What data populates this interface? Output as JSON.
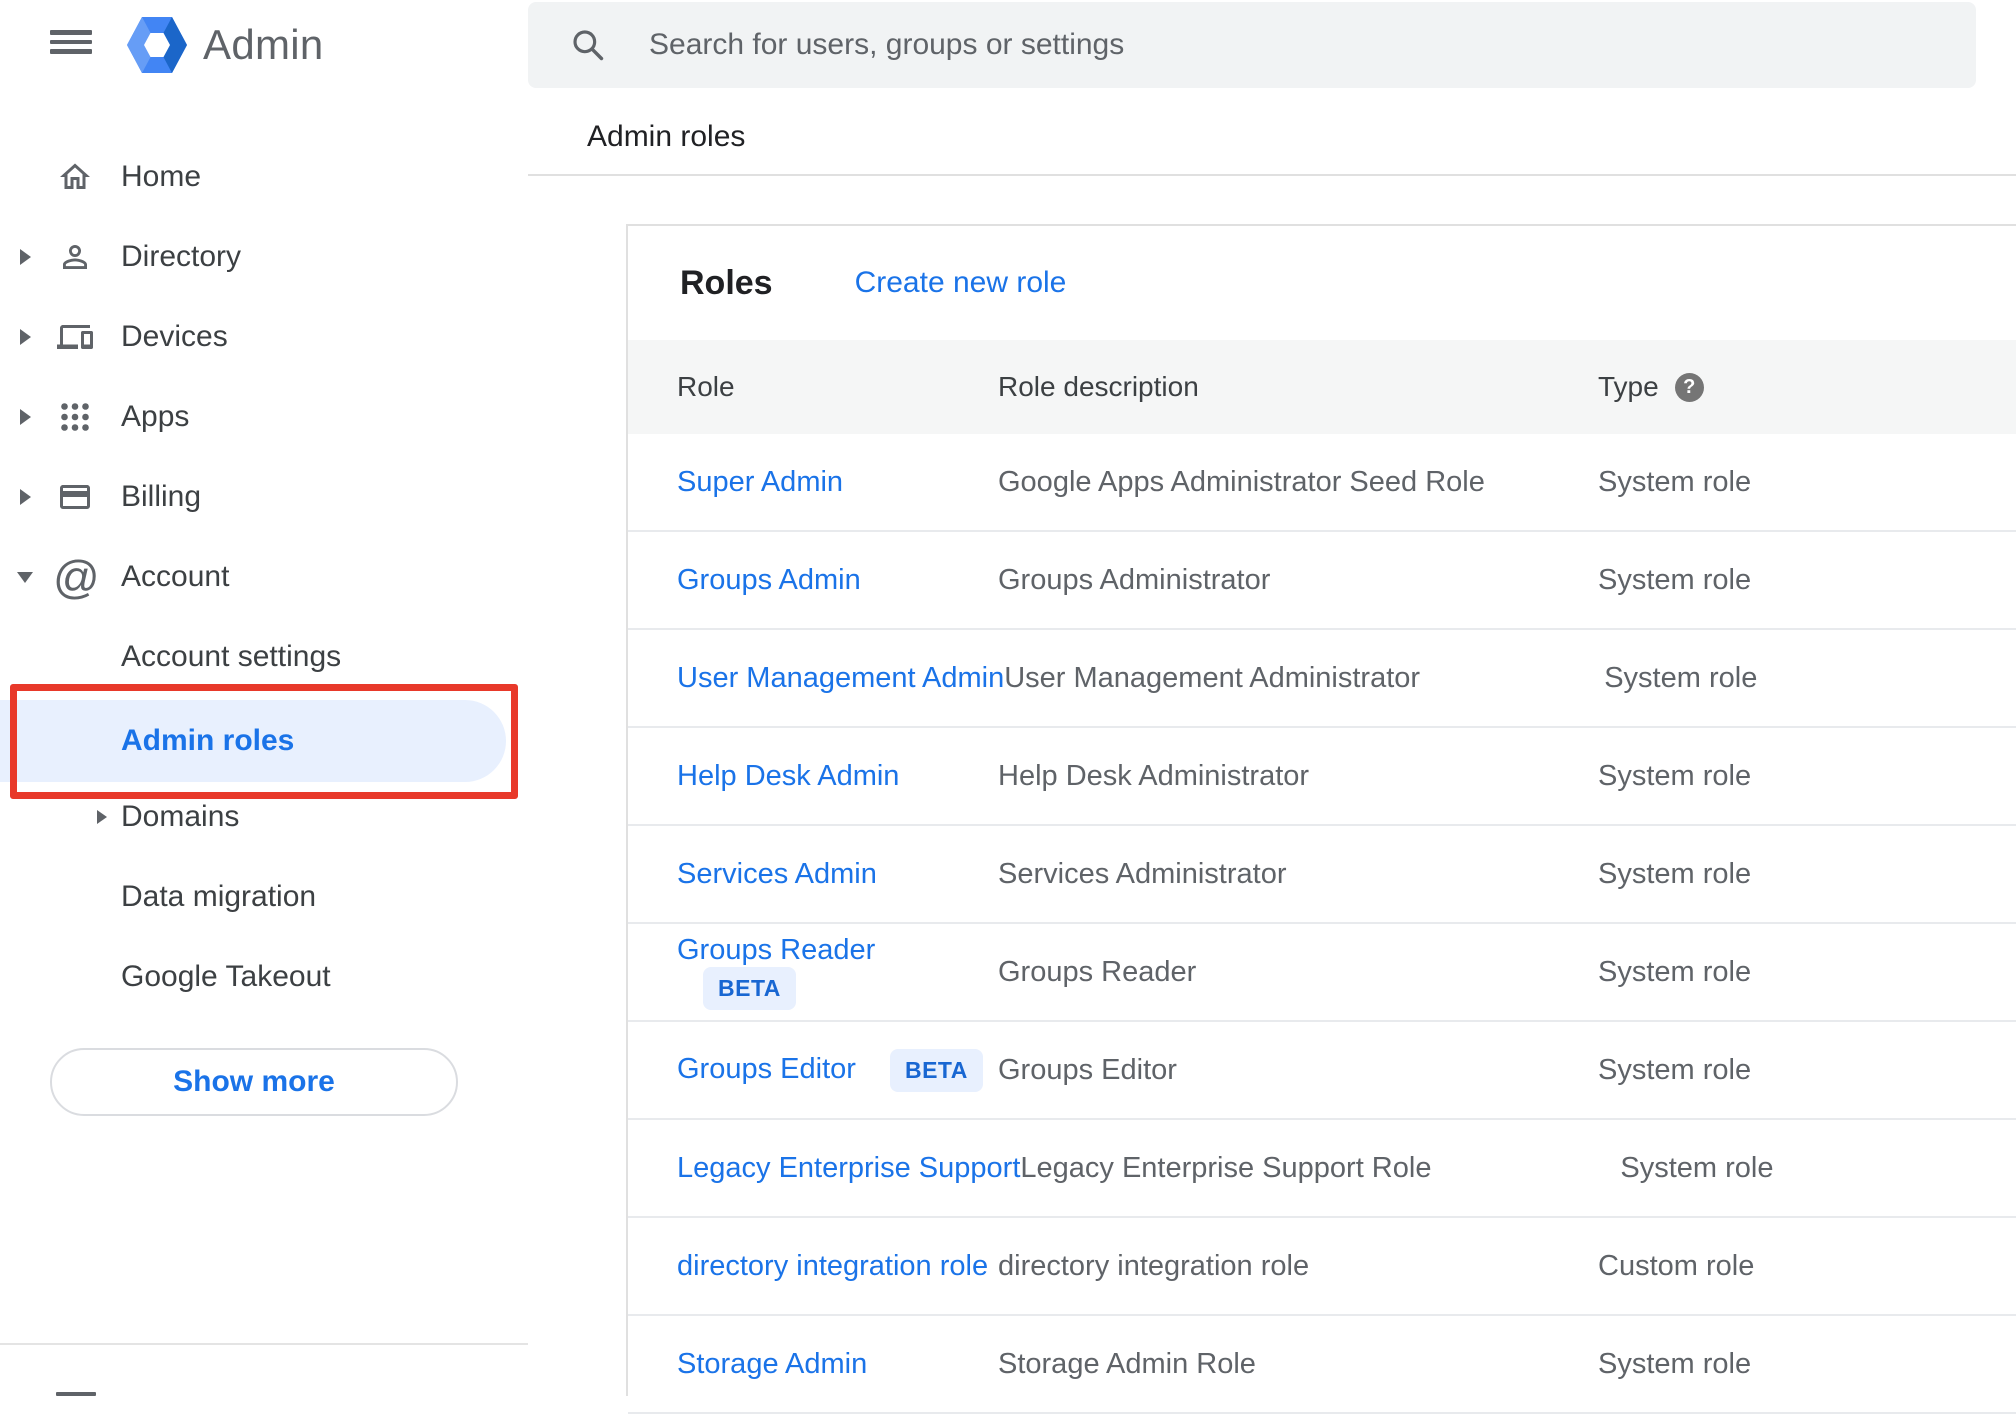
{
  "brand": {
    "app_name": "Admin"
  },
  "search": {
    "placeholder": "Search for users, groups or settings"
  },
  "breadcrumb": "Admin roles",
  "sidebar": {
    "items": [
      {
        "label": "Home"
      },
      {
        "label": "Directory"
      },
      {
        "label": "Devices"
      },
      {
        "label": "Apps"
      },
      {
        "label": "Billing"
      },
      {
        "label": "Account"
      }
    ],
    "account_subitems": [
      {
        "label": "Account settings"
      },
      {
        "label": "Admin roles",
        "active": true
      },
      {
        "label": "Domains"
      },
      {
        "label": "Data migration"
      },
      {
        "label": "Google Takeout"
      }
    ],
    "show_more_label": "Show more"
  },
  "roles_panel": {
    "title": "Roles",
    "create_link": "Create new role",
    "columns": {
      "role": "Role",
      "description": "Role description",
      "type": "Type"
    },
    "help_icon_glyph": "?",
    "rows": [
      {
        "role": "Super Admin",
        "description": "Google Apps Administrator Seed Role",
        "type": "System role"
      },
      {
        "role": "Groups Admin",
        "description": "Groups Administrator",
        "type": "System role"
      },
      {
        "role": "User Management Admin",
        "description": "User Management Administrator",
        "type": "System role"
      },
      {
        "role": "Help Desk Admin",
        "description": "Help Desk Administrator",
        "type": "System role"
      },
      {
        "role": "Services Admin",
        "description": "Services Administrator",
        "type": "System role"
      },
      {
        "role": "Groups Reader",
        "badge": "BETA",
        "description": "Groups Reader",
        "type": "System role"
      },
      {
        "role": "Groups Editor",
        "badge": "BETA",
        "description": "Groups Editor",
        "type": "System role"
      },
      {
        "role": "Legacy Enterprise Support",
        "description": "Legacy Enterprise Support Role",
        "type": "System role"
      },
      {
        "role": "directory integration role",
        "description": "directory integration role",
        "type": "Custom role"
      },
      {
        "role": "Storage Admin",
        "description": "Storage Admin Role",
        "type": "System role"
      }
    ]
  },
  "colors": {
    "accent_blue": "#1a73e8",
    "active_item_bg": "#e8f0fe",
    "annotation_red": "#e8392a",
    "beta_bg": "#e8f0fe",
    "beta_text": "#1967d2",
    "logo_blue": "#4285f4",
    "table_header_bg": "#f5f6f6",
    "muted_text": "#5f6368"
  }
}
